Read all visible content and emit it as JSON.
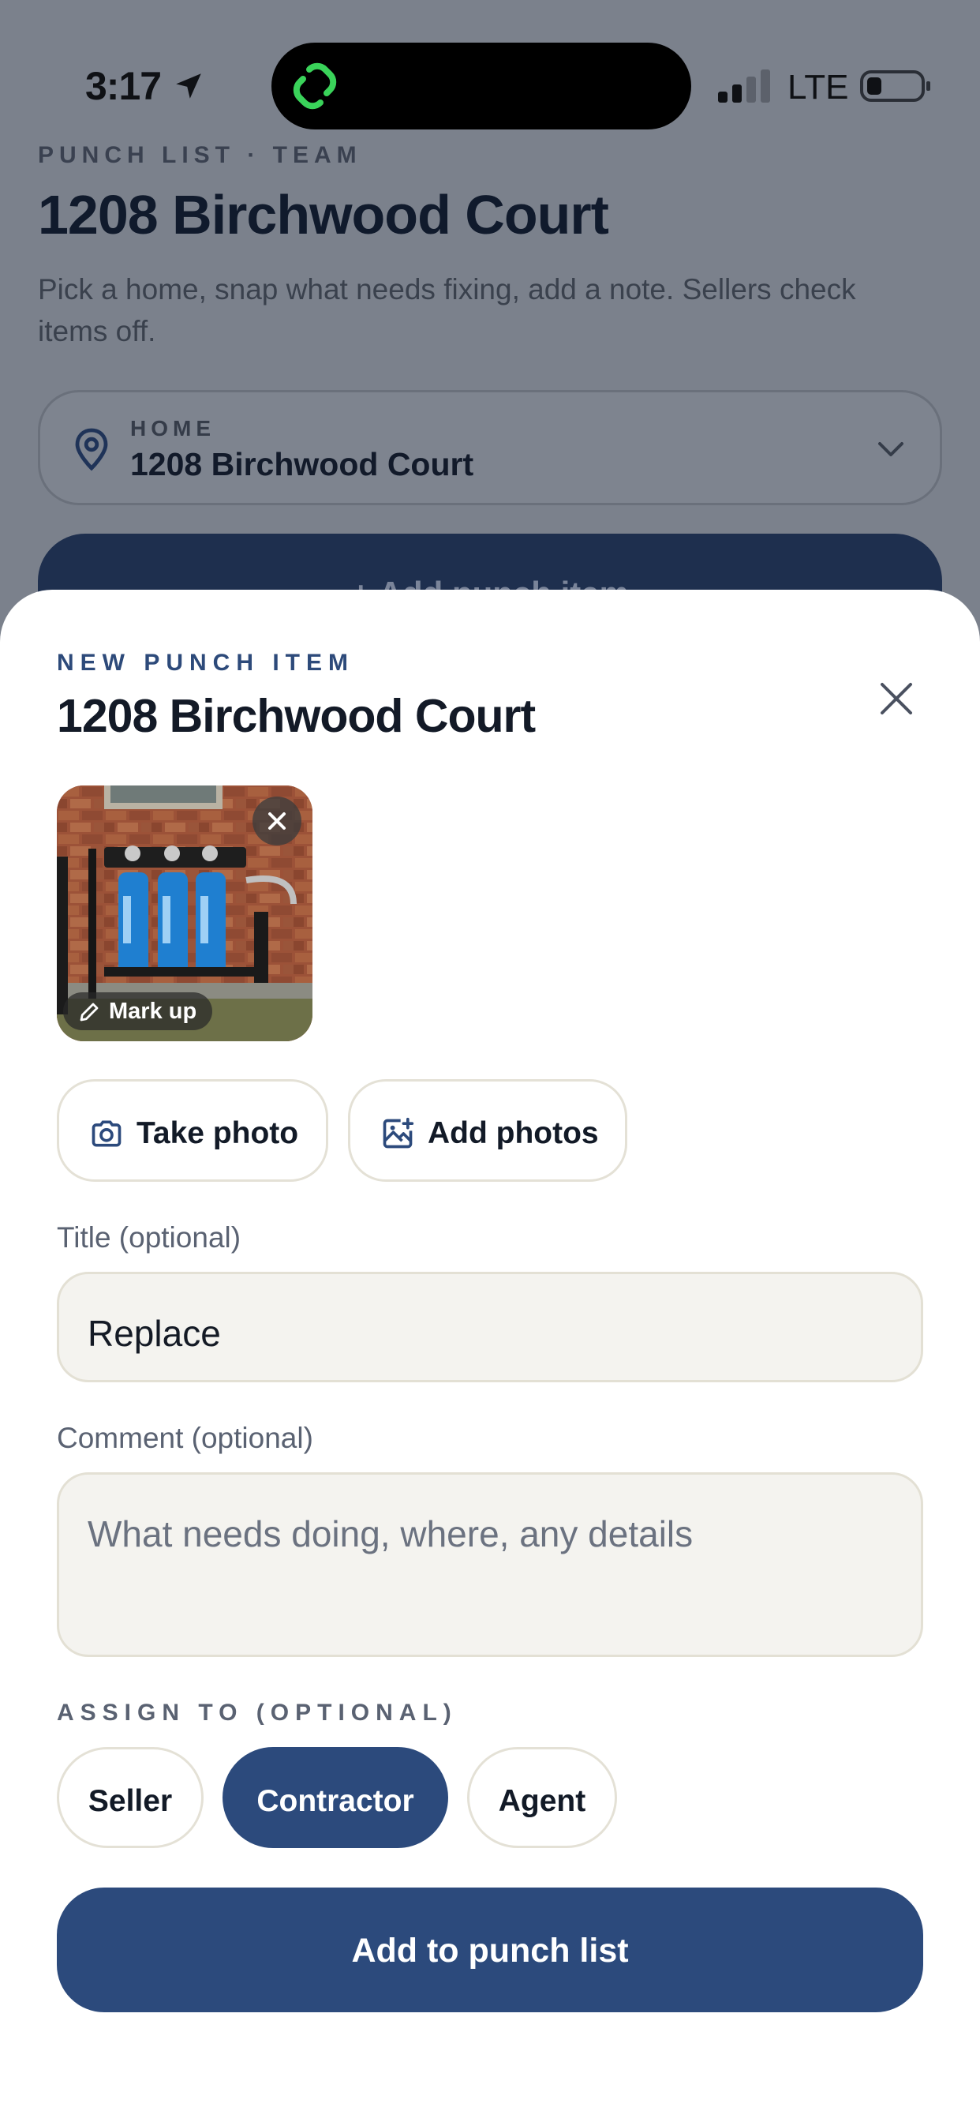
{
  "status_bar": {
    "time": "3:17",
    "network": "LTE"
  },
  "background": {
    "eyebrow": "PUNCH LIST · TEAM",
    "title": "1208 Birchwood Court",
    "description": "Pick a home, snap what needs fixing, add a note. Sellers check items off.",
    "home_select": {
      "label": "HOME",
      "value": "1208 Birchwood Court"
    },
    "add_button_label": "+ Add punch item"
  },
  "sheet": {
    "eyebrow": "NEW PUNCH ITEM",
    "title": "1208 Birchwood Court",
    "photo": {
      "markup_label": "Mark up"
    },
    "take_photo_label": "Take photo",
    "add_photos_label": "Add photos",
    "title_field": {
      "label": "Title (optional)",
      "value": "Replace"
    },
    "comment_field": {
      "label": "Comment (optional)",
      "placeholder": "What needs doing, where, any details"
    },
    "assign": {
      "label": "ASSIGN TO (OPTIONAL)",
      "options": [
        "Seller",
        "Contractor",
        "Agent"
      ],
      "selected": "Contractor"
    },
    "submit_label": "Add to punch list"
  },
  "colors": {
    "accent": "#2c4a7c",
    "sheet_bg": "#ffffff",
    "field_bg": "#f4f3ef",
    "island_icon": "#3ad35a"
  }
}
